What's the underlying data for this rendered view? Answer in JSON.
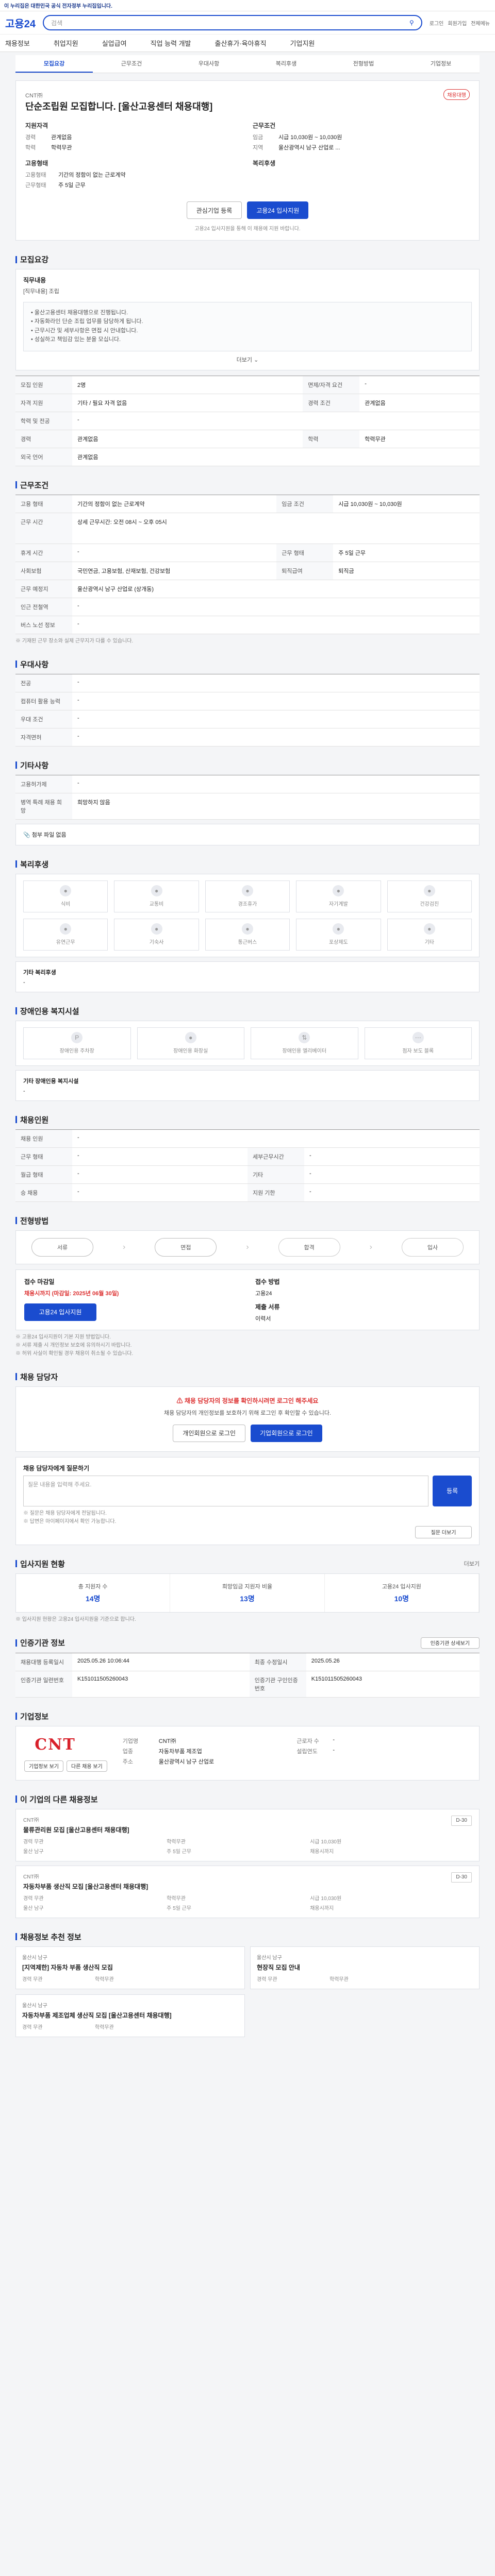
{
  "topbar": {
    "gov": "이 누리집은 대한민국 공식 전자정부 누리집입니다."
  },
  "header": {
    "logo": "고용24",
    "search_placeholder": "검색",
    "links": [
      "로그인",
      "회원가입",
      "전체메뉴"
    ],
    "nav": [
      "채용정보",
      "취업지원",
      "실업급여",
      "직업 능력 개발",
      "출산휴가·육아휴직",
      "기업지원"
    ]
  },
  "tabs": [
    "모집요강",
    "근무조건",
    "우대사항",
    "복리후생",
    "전형방법",
    "기업정보"
  ],
  "summary": {
    "company": "CNT㈜",
    "title": "단순조립원 모집합니다. [울산고용센터 채용대행]",
    "badge": "채용대행",
    "qual_h": "지원자격",
    "qual": [
      {
        "k": "경력",
        "v": "관계없음"
      },
      {
        "k": "학력",
        "v": "학력무관"
      }
    ],
    "cond_h": "근무조건",
    "cond": [
      {
        "k": "임금",
        "v": "시급 10,030원 ~ 10,030원"
      },
      {
        "k": "지역",
        "v": "울산광역시 남구 산업로 ..."
      }
    ],
    "form_h": "고용형태",
    "form": [
      {
        "k": "고용형태",
        "v": "기간의 정함이 없는 근로계약"
      },
      {
        "k": "근무형태",
        "v": "주 5일 근무"
      }
    ],
    "welfare_h": "복리후생",
    "btn_interest": "관심기업 등록",
    "btn_apply": "고용24 입사지원",
    "apply_note": "고용24 입사지원을 통해 이 채용에 지원 바랍니다."
  },
  "recruit": {
    "title": "모집요강",
    "job_h": "직무내용",
    "job_text": "[직무내용] 조립",
    "notes": [
      "울산고용센터 채용대행으로 진행됩니다.",
      "자동화라인 단순 조립 업무를 담당하게 됩니다.",
      "근무시간 및 세부사항은 면접 시 안내합니다.",
      "성실하고 책임감 있는 분을 모십니다."
    ],
    "more": "더보기",
    "rows": [
      {
        "k": "모집 인원",
        "v": "2명",
        "k2": "면제/자격 요건",
        "v2": "-"
      },
      {
        "k": "자격 지원",
        "v": "기타 / 필요 자격 없음",
        "k2": "경력 조건",
        "v2": "관계없음"
      },
      {
        "k": "학력 및 전공",
        "v": "-",
        "k2": "",
        "v2": ""
      },
      {
        "k": "경력",
        "v": "관계없음",
        "k2": "학력",
        "v2": "학력무관"
      },
      {
        "k": "외국 언어",
        "v": "관계없음",
        "k2": "",
        "v2": ""
      }
    ]
  },
  "work": {
    "title": "근무조건",
    "rows": [
      {
        "k": "고용 형태",
        "v": "기간의 정함이 없는 근로계약",
        "k2": "임금 조건",
        "v2": "시급 10,030원 ~ 10,030원"
      },
      {
        "k": "근무 시간",
        "v": "상세 근무시간: 오전 08시 ~ 오후 05시",
        "k2": "",
        "v2": ""
      },
      {
        "k": "휴게 시간",
        "v": "-",
        "k2": "근무 형태",
        "v2": "주 5일 근무"
      },
      {
        "k": "사회보험",
        "v": "국민연금, 고용보험, 산재보험, 건강보험",
        "k2": "퇴직급여",
        "v2": "퇴직금"
      },
      {
        "k": "근무 예정지",
        "v": "울산광역시 남구 산업로 (상개동)",
        "k2": "",
        "v2": ""
      },
      {
        "k": "인근 전철역",
        "v": "-",
        "k2": "",
        "v2": ""
      },
      {
        "k": "버스 노선 정보",
        "v": "-",
        "k2": "",
        "v2": ""
      }
    ],
    "note": "※ 기재된 근무 장소와 실제 근무지가 다를 수 있습니다."
  },
  "prefer": {
    "title": "우대사항",
    "rows": [
      {
        "k": "전공",
        "v": "-"
      },
      {
        "k": "컴퓨터 활용 능력",
        "v": "-"
      },
      {
        "k": "우대 조건",
        "v": "-"
      },
      {
        "k": "자격면허",
        "v": "-"
      }
    ]
  },
  "etc": {
    "title": "기타사항",
    "rows": [
      {
        "k": "고용허가제",
        "v": "-"
      },
      {
        "k": "병역 특례 채용 희망",
        "v": "희망하지 않음"
      }
    ],
    "attach": "첨부 파일 없음"
  },
  "welfare": {
    "title": "복리후생",
    "icons": [
      "식비",
      "교통비",
      "경조휴가",
      "자기계발",
      "건강검진",
      "유연근무",
      "기숙사",
      "통근버스",
      "포상제도",
      "기타"
    ],
    "etc_label": "기타 복리후생",
    "etc_value": "-"
  },
  "disabled": {
    "title": "장애인용 복지시설",
    "icons": [
      "장애인용 주차장",
      "장애인용 화장실",
      "장애인용 엘리베이터",
      "점자 보도 블록"
    ],
    "etc_label": "기타 장애인용 복지시설",
    "etc_value": "-"
  },
  "worktime": {
    "title": "채용인원",
    "rows": [
      {
        "k": "채용 인원",
        "v": "-",
        "k2": "",
        "v2": ""
      },
      {
        "k": "근무 형태",
        "v": "-",
        "k2": "세부근무시간",
        "v2": "-"
      },
      {
        "k": "월급 형태",
        "v": "-",
        "k2": "기타",
        "v2": "-"
      },
      {
        "k": "승 채용",
        "v": "-",
        "k2": "지원 기한",
        "v2": "-"
      }
    ]
  },
  "process": {
    "title": "전형방법",
    "steps": [
      "서류",
      "면접",
      "합격",
      "입사"
    ],
    "apply_h": "접수 마감일",
    "apply_deadline": "채용시까지 (마감일: 2025년 06월 30일)",
    "apply_way_h": "접수 방법",
    "apply_way": "고용24",
    "submit_h": "제출 서류",
    "submit": "이력서",
    "apply_btn": "고용24 입사지원",
    "notes": [
      "※ 고용24 입사지원이 기본 지원 방법입니다.",
      "※ 서류 제출 시 개인정보 보호에 유의하시기 바랍니다.",
      "※ 허위 사실이 확인될 경우 채용이 취소될 수 있습니다."
    ]
  },
  "contact": {
    "title": "채용 담당자",
    "warn": "채용 담당자의 정보를 확인하시려면 로그인 해주세요",
    "text1": "채용 담당자의 개인정보를 보호하기 위해 로그인 후 확인할 수 있습니다.",
    "btn1": "개인회원으로 로그인",
    "btn2": "기업회원으로 로그인",
    "question_h": "채용 담당자에게 질문하기",
    "question_placeholder": "질문 내용을 입력해 주세요.",
    "submit": "등록",
    "notes": [
      "※ 질문은 채용 담당자에게 전달됩니다.",
      "※ 답변은 마이페이지에서 확인 가능합니다."
    ],
    "more_btn": "질문 더보기"
  },
  "status": {
    "title": "입사지원 현황",
    "more": "더보기",
    "stats": [
      {
        "label": "총 지원자 수",
        "value": "14명"
      },
      {
        "label": "희망임금 지원자 비율",
        "value": "13명"
      },
      {
        "label": "고용24 입사지원",
        "value": "10명"
      }
    ],
    "note": "※ 입사지원 현황은 고용24 입사지원을 기준으로 합니다."
  },
  "info": {
    "title": "인증기관 정보",
    "btn": "인증기관 상세보기",
    "rows": [
      {
        "k": "채용대행 등록일시",
        "v": "2025.05.26 10:06:44",
        "k2": "최종 수정일시",
        "v2": "2025.05.26"
      },
      {
        "k": "인증기관 일련번호",
        "v": "K151011505260043",
        "k2": "인증기관 구인인증번호",
        "v2": "K151011505260043"
      }
    ]
  },
  "company": {
    "title": "기업정보",
    "logo": "CNT",
    "industry_h": "기업명",
    "industry": "CNT㈜",
    "size_h": "업종",
    "size": "자동차부품 제조업",
    "emp_h": "근로자 수",
    "emp": "-",
    "cap_h": "설립연도",
    "cap": "-",
    "addr_h": "주소",
    "addr": "울산광역시 남구 산업로",
    "btns": [
      "기업정보 보기",
      "다른 채용 보기"
    ]
  },
  "others": {
    "title": "이 기업의 다른 채용정보",
    "items": [
      {
        "company": "CNT㈜",
        "title": "물류관리원 모집 [울산고용센터 채용대행]",
        "meta": [
          "경력 무관",
          "학력무관",
          "시급 10,030원",
          "울산 남구",
          "주 5일 근무",
          "채용시까지"
        ],
        "dday": "D-30"
      },
      {
        "company": "CNT㈜",
        "title": "자동차부품 생산직 모집 [울산고용센터 채용대행]",
        "meta": [
          "경력 무관",
          "학력무관",
          "시급 10,030원",
          "울산 남구",
          "주 5일 근무",
          "채용시까지"
        ],
        "dday": "D-30"
      }
    ]
  },
  "recommend": {
    "title": "채용정보 추천 정보",
    "items": [
      {
        "company": "울산시 남구",
        "title": "[지역제한] 자동차 부품 생산직 모집",
        "meta": [
          "경력 무관",
          "학력무관"
        ]
      },
      {
        "company": "울산시 남구",
        "title": "현장직 모집 안내",
        "meta": [
          "경력 무관",
          "학력무관"
        ]
      },
      {
        "company": "울산시 남구",
        "title": "자동차부품 제조업체 생산직 모집 [울산고용센터 채용대행]",
        "meta": [
          "경력 무관",
          "학력무관"
        ]
      }
    ]
  }
}
